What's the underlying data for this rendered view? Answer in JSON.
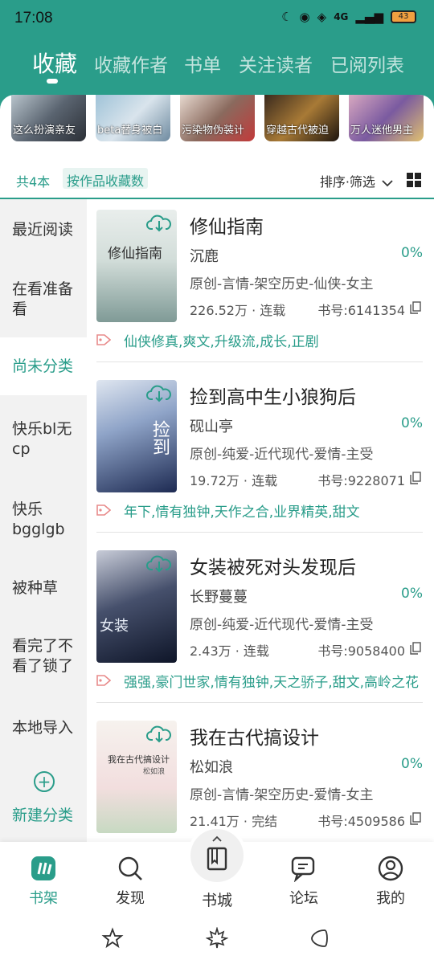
{
  "status_bar": {
    "time": "17:08",
    "network": "4G",
    "battery": "43"
  },
  "tabs": [
    {
      "label": "收藏"
    },
    {
      "label": "收藏作者"
    },
    {
      "label": "书单"
    },
    {
      "label": "关注读者"
    },
    {
      "label": "已阅列表"
    }
  ],
  "recent_books": [
    {
      "label": "这么扮演亲友"
    },
    {
      "label": "beta替身被白"
    },
    {
      "label": "污染物伪装计"
    },
    {
      "label": "穿越古代被迫"
    },
    {
      "label": "万人迷他男主"
    }
  ],
  "toolbar": {
    "count": "共4本",
    "sort_chip": "按作品收藏数",
    "sort_filter": "排序·筛选"
  },
  "categories": [
    {
      "label": "最近阅读"
    },
    {
      "label": "在看准备看"
    },
    {
      "label": "尚未分类"
    },
    {
      "label": "快乐bl无cp"
    },
    {
      "label": "快乐bgglgb"
    },
    {
      "label": "被种草"
    },
    {
      "label": "看完了不看了锁了"
    },
    {
      "label": "本地导入"
    }
  ],
  "new_category": {
    "label": "新建分类"
  },
  "books": [
    {
      "title": "修仙指南",
      "author": "沉鹿",
      "progress": "0%",
      "genre": "原创-言情-架空历史-仙侠-女主",
      "words": "226.52万 · 连载",
      "book_no": "书号:6141354",
      "tags": "仙侠修真,爽文,升级流,成长,正剧",
      "cover_text": "修仙指南"
    },
    {
      "title": "捡到高中生小狼狗后",
      "author": "砚山亭",
      "progress": "0%",
      "genre": "原创-纯爱-近代现代-爱情-主受",
      "words": "19.72万 · 连载",
      "book_no": "书号:9228071",
      "tags": "年下,情有独钟,天作之合,业界精英,甜文",
      "cover_text": "捡到"
    },
    {
      "title": "女装被死对头发现后",
      "author": "长野蔓蔓",
      "progress": "0%",
      "genre": "原创-纯爱-近代现代-爱情-主受",
      "words": "2.43万 · 连载",
      "book_no": "书号:9058400",
      "tags": "强强,豪门世家,情有独钟,天之骄子,甜文,高岭之花",
      "cover_text": "女装"
    },
    {
      "title": "我在古代搞设计",
      "author": "松如浪",
      "progress": "0%",
      "genre": "原创-言情-架空历史-爱情-女主",
      "words": "21.41万 · 完结",
      "book_no": "书号:4509586",
      "tags": "",
      "cover_text": "我在古代搞设计",
      "cover_sub": "松如浪"
    }
  ],
  "bottom_nav": [
    {
      "label": "书架"
    },
    {
      "label": "发现"
    },
    {
      "label": "书城"
    },
    {
      "label": "论坛"
    },
    {
      "label": "我的"
    }
  ],
  "colors": {
    "accent": "#2a9d8a",
    "tag_icon": "#e88a8a"
  }
}
